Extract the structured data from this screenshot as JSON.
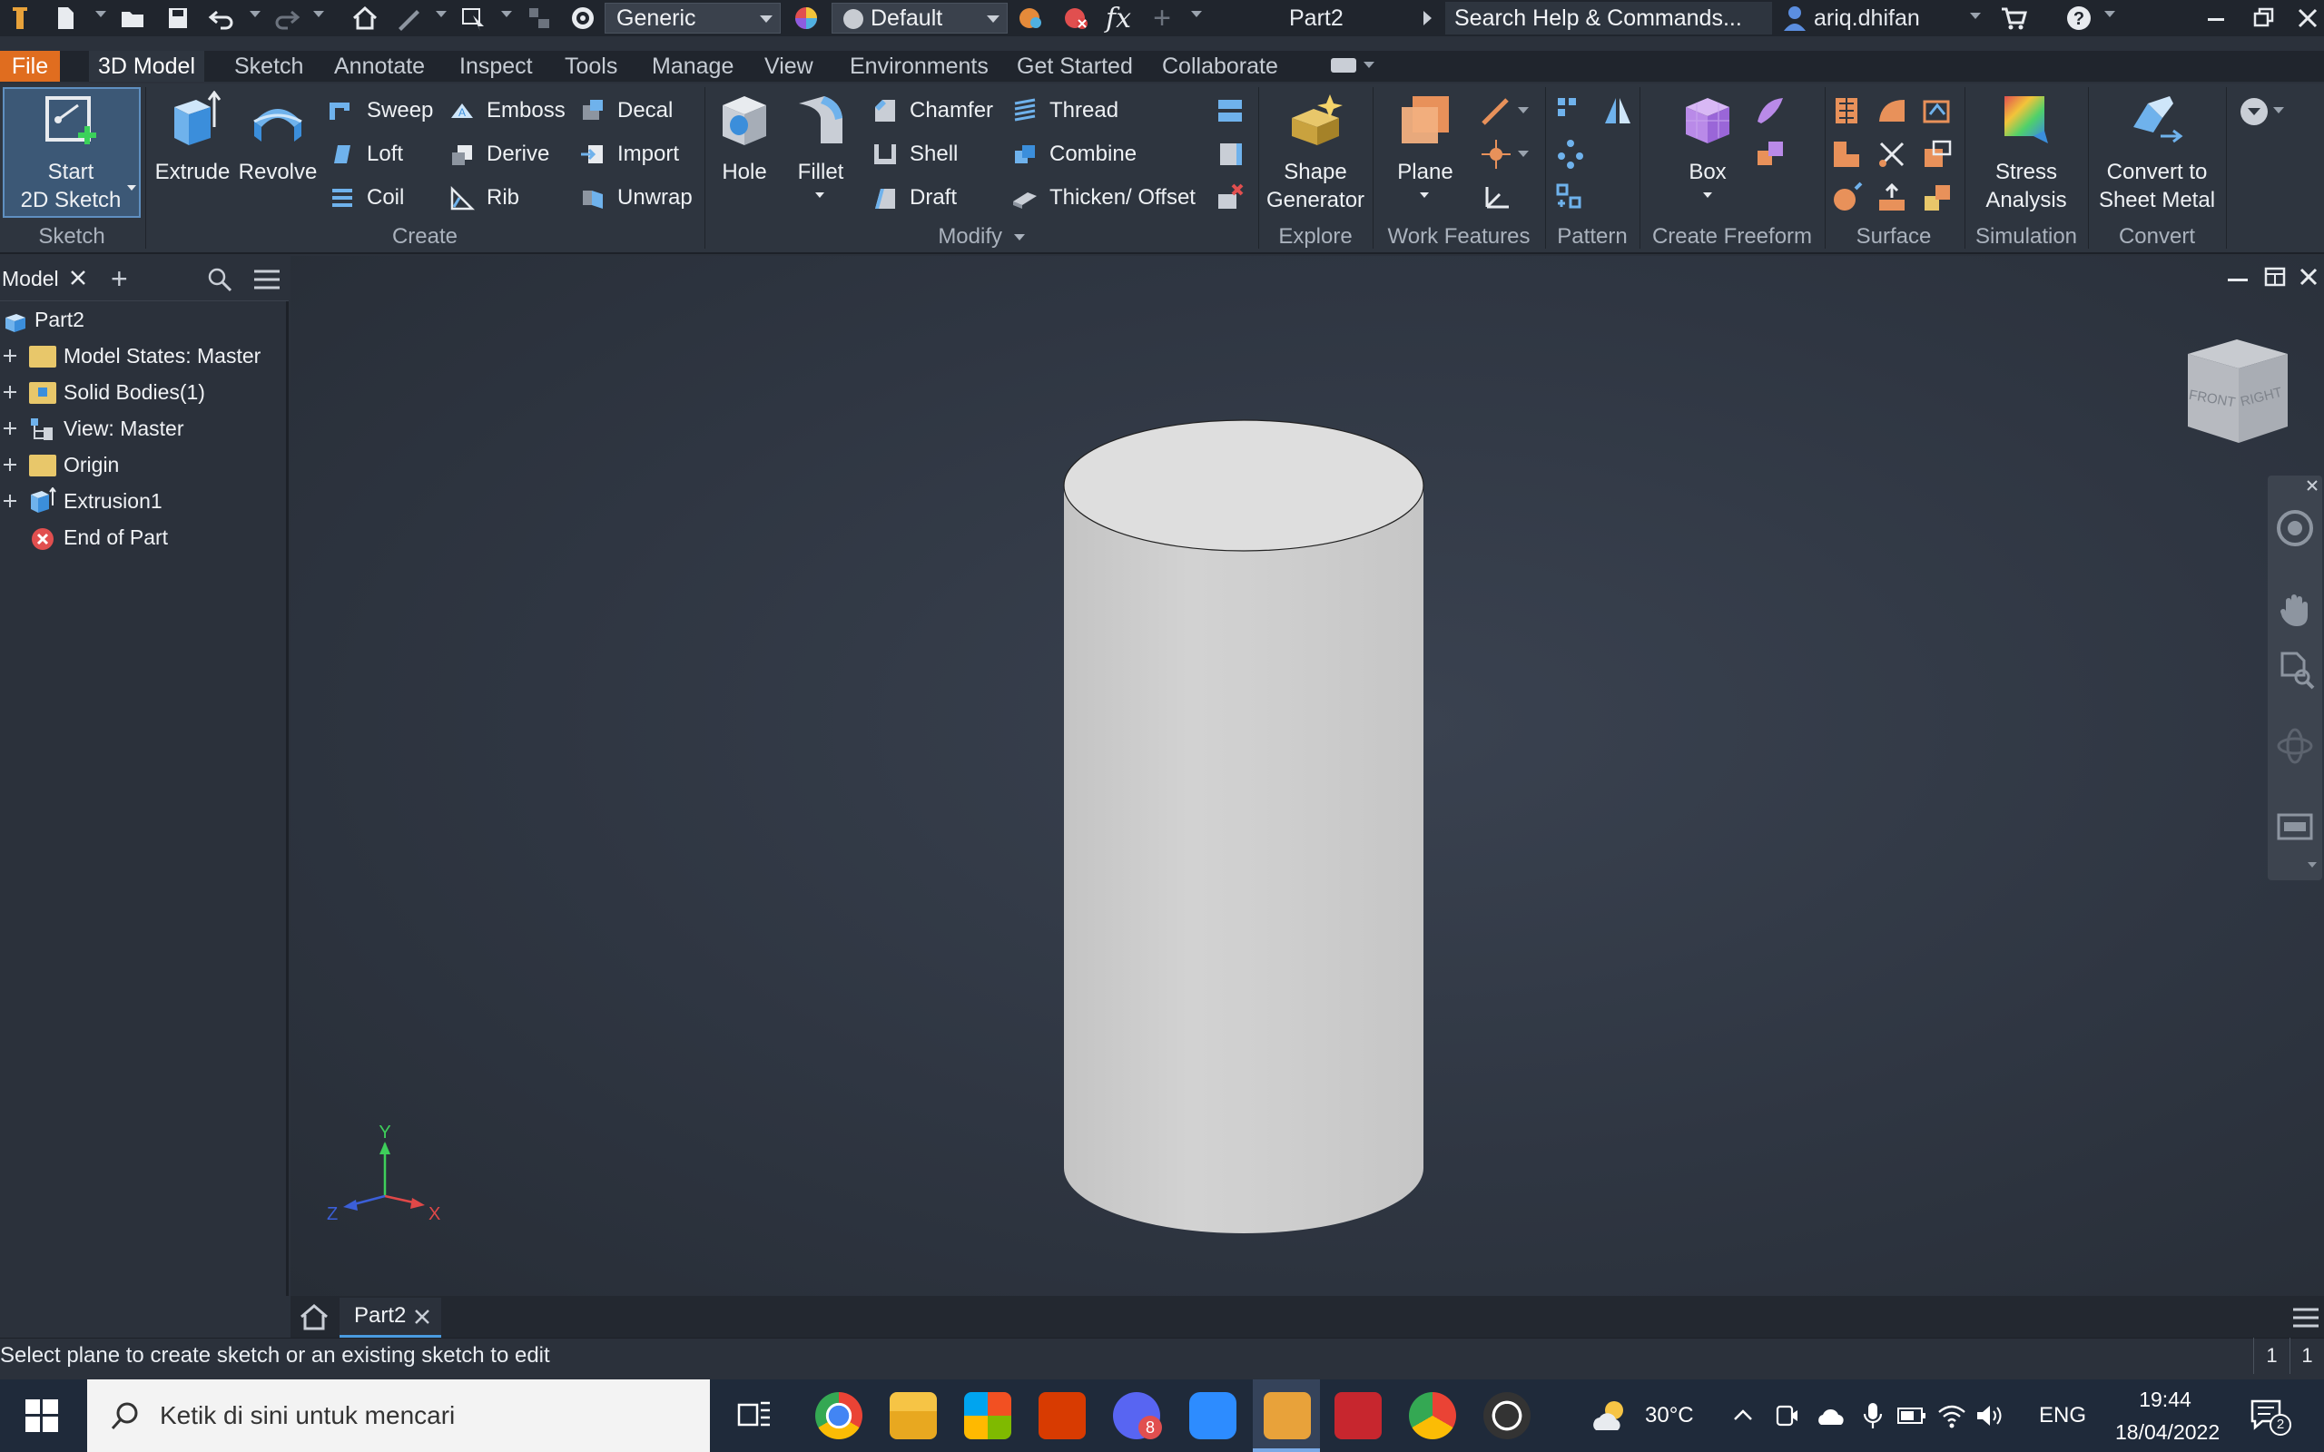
{
  "app": {
    "doc_title": "Part2",
    "search_placeholder": "Search Help & Commands...",
    "user": "ariq.dhifan"
  },
  "quick_access": {
    "appearance_combo": "Generic",
    "material_combo": "Default",
    "fx_label": "fx"
  },
  "tabs": [
    "File",
    "3D Model",
    "Sketch",
    "Annotate",
    "Inspect",
    "Tools",
    "Manage",
    "View",
    "Environments",
    "Get Started",
    "Collaborate"
  ],
  "ribbon": {
    "sketch": {
      "title": "Sketch",
      "start_line1": "Start",
      "start_line2": "2D Sketch"
    },
    "create": {
      "title": "Create",
      "extrude": "Extrude",
      "revolve": "Revolve",
      "sweep": "Sweep",
      "loft": "Loft",
      "coil": "Coil",
      "emboss": "Emboss",
      "derive": "Derive",
      "rib": "Rib",
      "decal": "Decal",
      "import": "Import",
      "unwrap": "Unwrap"
    },
    "modify": {
      "title": "Modify",
      "hole": "Hole",
      "fillet": "Fillet",
      "chamfer": "Chamfer",
      "shell": "Shell",
      "draft": "Draft",
      "thread": "Thread",
      "combine": "Combine",
      "thicken": "Thicken/ Offset"
    },
    "explore": {
      "title": "Explore",
      "line1": "Shape",
      "line2": "Generator"
    },
    "work": {
      "title": "Work Features",
      "plane": "Plane"
    },
    "pattern": {
      "title": "Pattern"
    },
    "freeform": {
      "title": "Create Freeform",
      "box": "Box"
    },
    "surface": {
      "title": "Surface"
    },
    "simulation": {
      "title": "Simulation",
      "line1": "Stress",
      "line2": "Analysis"
    },
    "convert": {
      "title": "Convert",
      "line1": "Convert to",
      "line2": "Sheet Metal"
    }
  },
  "browser": {
    "tab": "Model",
    "root": "Part2",
    "items": [
      "Model States: Master",
      "Solid Bodies(1)",
      "View: Master",
      "Origin",
      "Extrusion1",
      "End of Part"
    ]
  },
  "viewcube": {
    "front": "FRONT",
    "right": "RIGHT"
  },
  "triad": {
    "x": "X",
    "y": "Y",
    "z": "Z"
  },
  "doc_tab": "Part2",
  "status": {
    "message": "Select plane to create sketch or an existing sketch to edit",
    "count1": "1",
    "count2": "1"
  },
  "taskbar": {
    "search_placeholder": "Ketik di sini untuk mencari",
    "weather": "30°C",
    "lang": "ENG",
    "time": "19:44",
    "date": "18/04/2022",
    "discord_badge": "8",
    "notif_count": "2"
  }
}
